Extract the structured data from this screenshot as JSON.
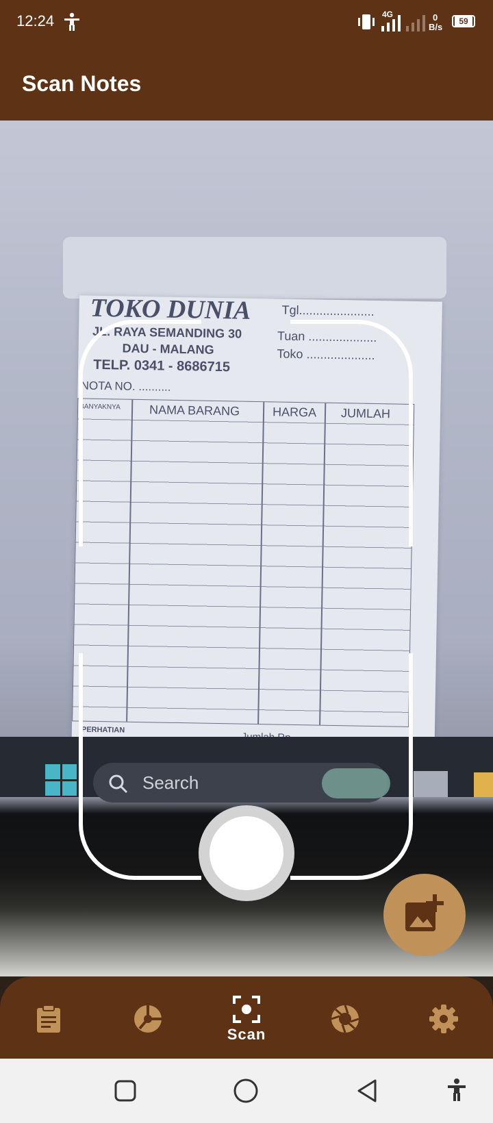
{
  "status": {
    "time": "12:24",
    "network": "4G",
    "speed_value": "0",
    "speed_unit": "B/s",
    "battery": "59"
  },
  "appbar": {
    "title": "Scan Notes"
  },
  "preview": {
    "receipt": {
      "store": "TOKO DUNIA",
      "address_line1": "JL. RAYA SEMANDING 30",
      "address_line2": "DAU - MALANG",
      "phone": "TELP. 0341 - 8686715",
      "note_no": "NOTA NO. ..........",
      "date_label": "Tgl......................",
      "to_label": "Tuan ....................",
      "shop_label": "Toko ....................",
      "columns": [
        "BANYAKNYA",
        "NAMA BARANG",
        "HARGA",
        "JUMLAH"
      ],
      "footer_left": "PERHATIAN",
      "footer_right": "Jumlah Rp."
    },
    "taskbar_search": "Search"
  },
  "navbar": {
    "active_label": "Scan"
  },
  "colors": {
    "brown": "#5e3214",
    "tan": "#c09158"
  }
}
